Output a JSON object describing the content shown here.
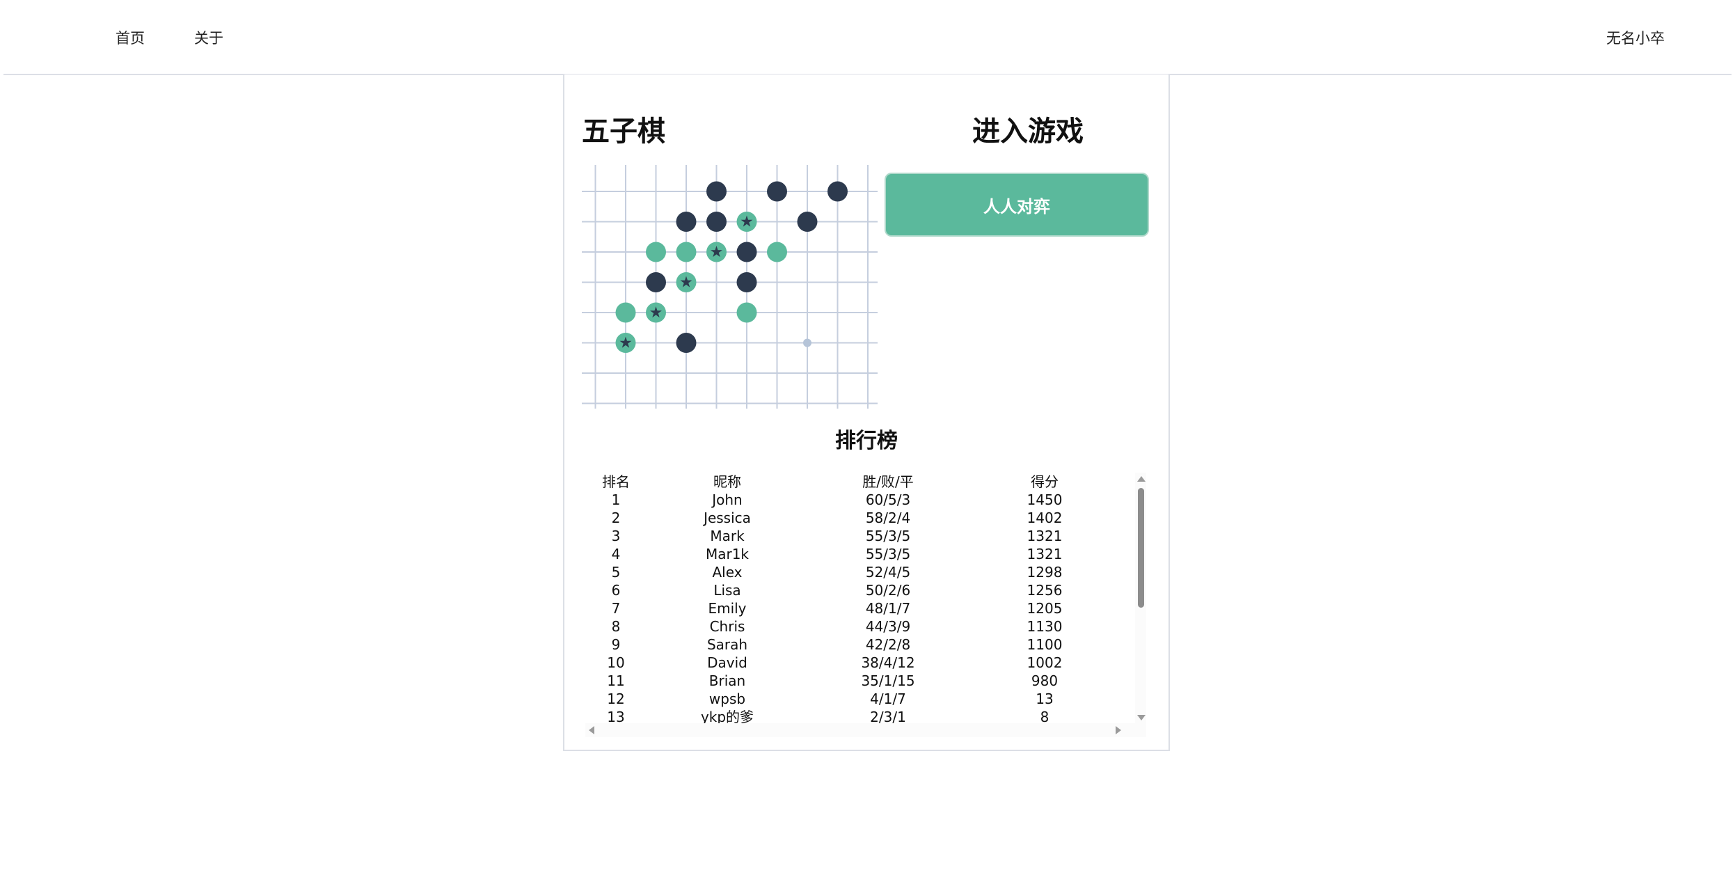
{
  "nav": {
    "home": "首页",
    "about": "关于",
    "user": "无名小卒"
  },
  "game": {
    "title": "五子棋",
    "enter_title": "进入游戏",
    "pvp_button": "人人对弈"
  },
  "colors": {
    "black_stone": "#2d3a4e",
    "green_stone": "#5bb99c",
    "grid_line": "#c5cede",
    "hint_dot": "#b5c4d8",
    "accent": "#5bb99c"
  },
  "board": {
    "stones": [
      {
        "col": 4,
        "row": 1,
        "color": "black"
      },
      {
        "col": 6,
        "row": 1,
        "color": "black"
      },
      {
        "col": 8,
        "row": 1,
        "color": "black"
      },
      {
        "col": 3,
        "row": 2,
        "color": "black"
      },
      {
        "col": 4,
        "row": 2,
        "color": "black"
      },
      {
        "col": 5,
        "row": 2,
        "color": "green",
        "star": true
      },
      {
        "col": 7,
        "row": 2,
        "color": "black"
      },
      {
        "col": 2,
        "row": 3,
        "color": "green"
      },
      {
        "col": 3,
        "row": 3,
        "color": "green"
      },
      {
        "col": 4,
        "row": 3,
        "color": "green",
        "star": true
      },
      {
        "col": 5,
        "row": 3,
        "color": "black"
      },
      {
        "col": 6,
        "row": 3,
        "color": "green"
      },
      {
        "col": 2,
        "row": 4,
        "color": "black"
      },
      {
        "col": 3,
        "row": 4,
        "color": "green",
        "star": true
      },
      {
        "col": 5,
        "row": 4,
        "color": "black"
      },
      {
        "col": 1,
        "row": 5,
        "color": "green"
      },
      {
        "col": 2,
        "row": 5,
        "color": "green",
        "star": true
      },
      {
        "col": 5,
        "row": 5,
        "color": "green"
      },
      {
        "col": 1,
        "row": 6,
        "color": "green",
        "star": true
      },
      {
        "col": 3,
        "row": 6,
        "color": "black"
      }
    ],
    "hint": {
      "col": 7,
      "row": 6
    }
  },
  "ranking": {
    "title": "排行榜",
    "headers": [
      "排名",
      "昵称",
      "胜/败/平",
      "得分"
    ],
    "rows": [
      [
        "1",
        "John",
        "60/5/3",
        "1450"
      ],
      [
        "2",
        "Jessica",
        "58/2/4",
        "1402"
      ],
      [
        "3",
        "Mark",
        "55/3/5",
        "1321"
      ],
      [
        "4",
        "Mar1k",
        "55/3/5",
        "1321"
      ],
      [
        "5",
        "Alex",
        "52/4/5",
        "1298"
      ],
      [
        "6",
        "Lisa",
        "50/2/6",
        "1256"
      ],
      [
        "7",
        "Emily",
        "48/1/7",
        "1205"
      ],
      [
        "8",
        "Chris",
        "44/3/9",
        "1130"
      ],
      [
        "9",
        "Sarah",
        "42/2/8",
        "1100"
      ],
      [
        "10",
        "David",
        "38/4/12",
        "1002"
      ],
      [
        "11",
        "Brian",
        "35/1/15",
        "980"
      ],
      [
        "12",
        "wpsb",
        "4/1/7",
        "13"
      ],
      [
        "13",
        "ykp的爹",
        "2/3/1",
        "8"
      ]
    ]
  }
}
